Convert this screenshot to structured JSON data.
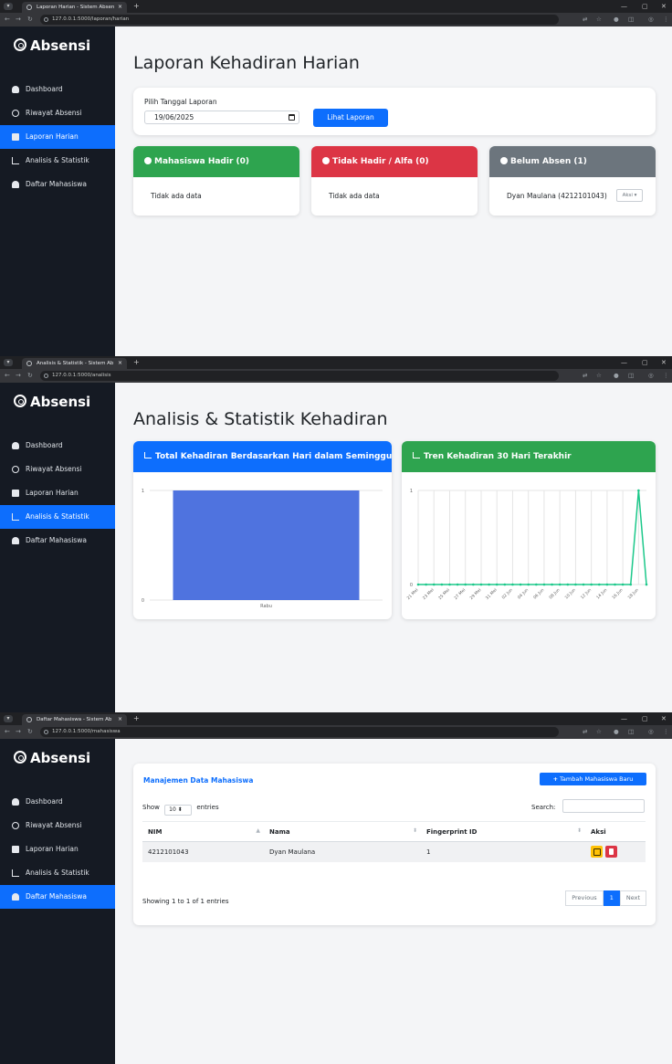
{
  "browser": {
    "shot1": {
      "tab_title": "Laporan Harian - Sistem Absen",
      "url": "127.0.0.1:5000/laporan/harian"
    },
    "shot2": {
      "tab_title": "Analisis & Statistik - Sistem Ab",
      "url": "127.0.0.1:5000/analisis"
    },
    "shot3": {
      "tab_title": "Daftar Mahasiswa - Sistem Ab",
      "url": "127.0.0.1:5000/mahasiswa"
    }
  },
  "sidebar": {
    "brand": "Absensi",
    "items": [
      {
        "label": "Dashboard",
        "icon": "gauge-icon"
      },
      {
        "label": "Riwayat Absensi",
        "icon": "fingerprint-icon"
      },
      {
        "label": "Laporan Harian",
        "icon": "calendar-icon"
      },
      {
        "label": "Analisis & Statistik",
        "icon": "chart-line-icon"
      },
      {
        "label": "Daftar Mahasiswa",
        "icon": "users-icon"
      }
    ],
    "active_index_by_shot": [
      2,
      3,
      4
    ]
  },
  "laporan": {
    "title": "Laporan Kehadiran Harian",
    "date_label": "Pilih Tanggal Laporan",
    "date_value": "19/06/2025",
    "button": "Lihat Laporan",
    "hadir": {
      "header": "Mahasiswa Hadir (0)",
      "body": "Tidak ada data",
      "color": "#2ea44f"
    },
    "tidak_hadir": {
      "header": "Tidak Hadir / Alfa (0)",
      "body": "Tidak ada data",
      "color": "#dc3545"
    },
    "belum_absen": {
      "header": "Belum Absen (1)",
      "body": "Dyan Maulana (4212101043)",
      "action": "Aksi ▾",
      "color": "#6c757d"
    }
  },
  "analisis": {
    "title": "Analisis & Statistik Kehadiran",
    "weekly_title": "Total Kehadiran Berdasarkan Hari dalam Seminggu",
    "trend_title": "Tren Kehadiran 30 Hari Terakhir"
  },
  "chart_data": [
    {
      "type": "bar",
      "title": "Total Kehadiran Berdasarkan Hari dalam Seminggu",
      "categories": [
        "Rabu"
      ],
      "values": [
        1
      ],
      "ylim": [
        0,
        1
      ],
      "yticks": [
        "0",
        "1"
      ],
      "color": "#4f73df"
    },
    {
      "type": "line",
      "title": "Tren Kehadiran 30 Hari Terakhir",
      "x": [
        "21 Mei",
        "22 Mei",
        "23 Mei",
        "24 Mei",
        "25 Mei",
        "26 Mei",
        "27 Mei",
        "28 Mei",
        "29 Mei",
        "30 Mei",
        "31 Mei",
        "01 Jun",
        "02 Jun",
        "03 Jun",
        "04 Jun",
        "05 Jun",
        "06 Jun",
        "07 Jun",
        "08 Jun",
        "09 Jun",
        "10 Jun",
        "11 Jun",
        "12 Jun",
        "13 Jun",
        "14 Jun",
        "15 Jun",
        "16 Jun",
        "17 Jun",
        "18 Jun",
        "19 Jun"
      ],
      "xtick_labels": [
        "21 Mei",
        "23 Mei",
        "25 Mei",
        "27 Mei",
        "29 Mei",
        "31 Mei",
        "02 Jun",
        "04 Jun",
        "06 Jun",
        "08 Jun",
        "10 Jun",
        "12 Jun",
        "14 Jun",
        "16 Jun",
        "18 Jun"
      ],
      "values": [
        0,
        0,
        0,
        0,
        0,
        0,
        0,
        0,
        0,
        0,
        0,
        0,
        0,
        0,
        0,
        0,
        0,
        0,
        0,
        0,
        0,
        0,
        0,
        0,
        0,
        0,
        0,
        0,
        1,
        0
      ],
      "ylim": [
        0,
        1
      ],
      "yticks": [
        "0",
        "1"
      ],
      "color": "#1cc88a"
    }
  ],
  "mahasiswa": {
    "title": "Manajemen Data Mahasiswa",
    "add_button": "Tambah Mahasiswa Baru",
    "show_prefix": "Show",
    "show_value": "10",
    "show_suffix": "entries",
    "search_label": "Search:",
    "columns": [
      "NIM",
      "Nama",
      "Fingerprint ID",
      "Aksi"
    ],
    "rows": [
      {
        "nim": "4212101043",
        "nama": "Dyan Maulana",
        "fingerprint": "1"
      }
    ],
    "info": "Showing 1 to 1 of 1 entries",
    "pager": {
      "previous": "Previous",
      "current": "1",
      "next": "Next"
    }
  }
}
